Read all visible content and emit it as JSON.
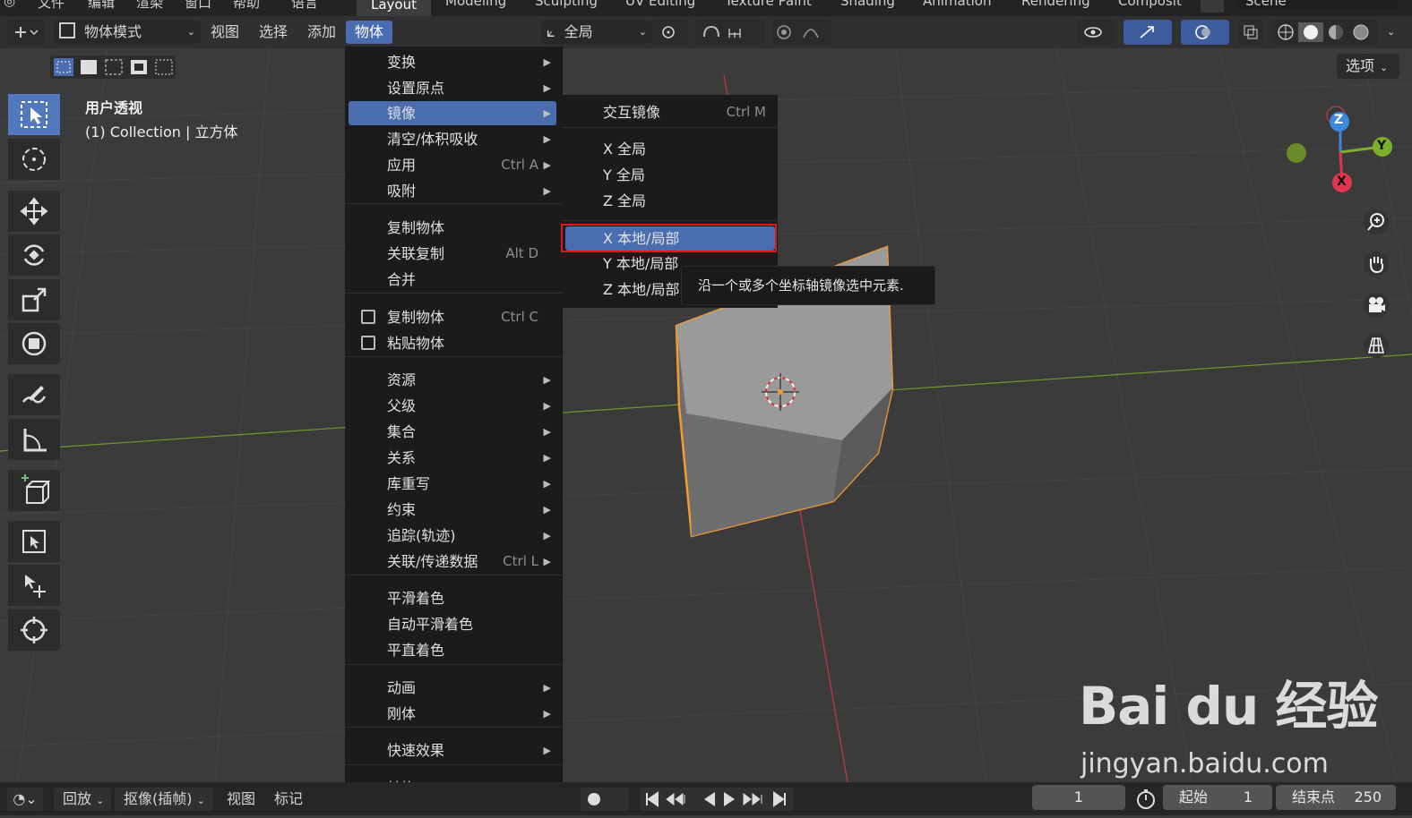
{
  "workspace_tabs": [
    "Layout",
    "Modeling",
    "Sculpting",
    "UV Editing",
    "Texture Paint",
    "Shading",
    "Animation",
    "Rendering",
    "Composit"
  ],
  "active_tab": "Layout",
  "scene_name": "Scene",
  "top_menu_partial": [
    "文件",
    "编辑",
    "渲染",
    "窗口",
    "帮助",
    "语言"
  ],
  "header": {
    "mode": "物体模式",
    "menus": [
      "视图",
      "选择",
      "添加",
      "物体"
    ],
    "transform_orientation": "全局",
    "options": "选项"
  },
  "viewport": {
    "view_name": "用户透视",
    "collection_info": "(1) Collection | 立方体"
  },
  "gizmo": {
    "z": "Z",
    "y": "Y",
    "x": "X"
  },
  "object_menu": {
    "items": [
      {
        "label": "变换",
        "submenu": true
      },
      {
        "label": "设置原点",
        "submenu": true
      },
      {
        "label": "镜像",
        "submenu": true,
        "highlight": true
      },
      {
        "label": "清空/体积吸收",
        "submenu": true
      },
      {
        "label": "应用",
        "shortcut": "Ctrl A",
        "submenu": true
      },
      {
        "label": "吸附",
        "submenu": true
      },
      {
        "label": "复制物体"
      },
      {
        "label": "关联复制",
        "shortcut": "Alt D"
      },
      {
        "label": "合并"
      },
      {
        "label": "复制物体",
        "shortcut": "Ctrl C"
      },
      {
        "label": "粘贴物体"
      },
      {
        "label": "资源",
        "submenu": true
      },
      {
        "label": "父级",
        "submenu": true
      },
      {
        "label": "集合",
        "submenu": true
      },
      {
        "label": "关系",
        "submenu": true
      },
      {
        "label": "库重写",
        "submenu": true
      },
      {
        "label": "约束",
        "submenu": true
      },
      {
        "label": "追踪(轨迹)",
        "submenu": true
      },
      {
        "label": "关联/传递数据",
        "shortcut": "Ctrl L",
        "submenu": true
      },
      {
        "label": "平滑着色"
      },
      {
        "label": "自动平滑着色"
      },
      {
        "label": "平直着色"
      },
      {
        "label": "动画",
        "submenu": true
      },
      {
        "label": "刚体",
        "submenu": true
      },
      {
        "label": "快速效果",
        "submenu": true
      },
      {
        "label": "转换",
        "submenu": true
      }
    ]
  },
  "mirror_submenu": {
    "items": [
      {
        "label": "交互镜像",
        "shortcut": "Ctrl M"
      },
      {
        "label": "X 全局"
      },
      {
        "label": "Y 全局"
      },
      {
        "label": "Z 全局"
      },
      {
        "label": "X 本地/局部",
        "highlight": true
      },
      {
        "label": "Y 本地/局部"
      },
      {
        "label": "Z 本地/局部"
      }
    ]
  },
  "tooltip": "沿一个或多个坐标轴镜像选中元素.",
  "timeline": {
    "playback": "回放",
    "keying": "抠像(插帧)",
    "view": "视图",
    "marker": "标记",
    "current_frame": "1",
    "start_label": "起始",
    "start_value": "1",
    "end_label": "结束点",
    "end_value": "250"
  },
  "watermark": {
    "brand": "Bai du 经验",
    "url": "jingyan.baidu.com"
  },
  "colors": {
    "accent": "#4a6db0",
    "selection_outline": "#f59a2c",
    "red_highlight": "#e01818",
    "axis_red": "#c23a45",
    "axis_green": "#6e9a2a"
  }
}
